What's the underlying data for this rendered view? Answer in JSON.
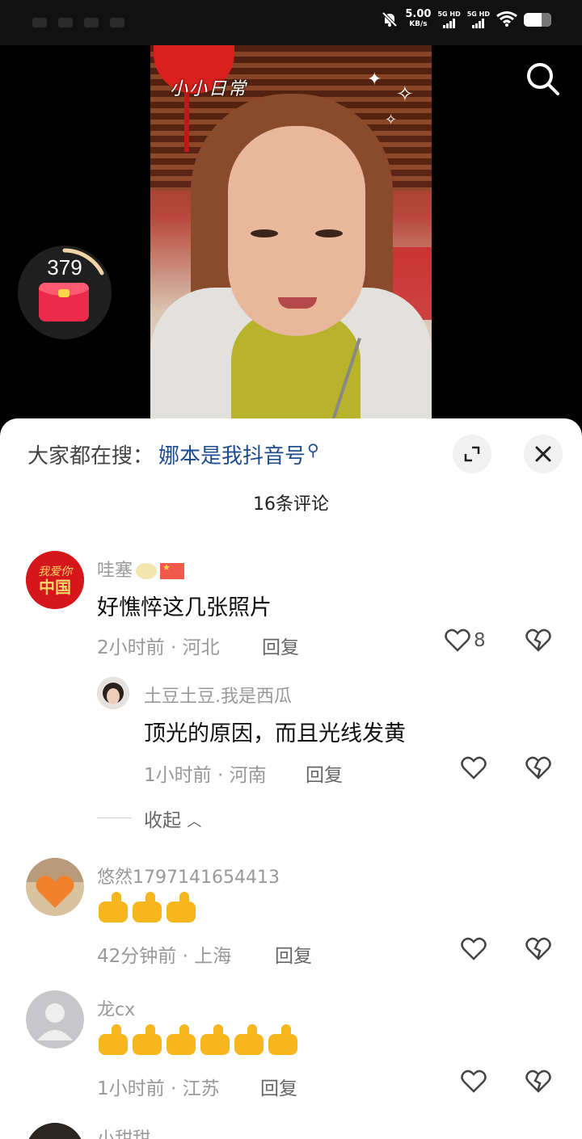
{
  "status_bar": {
    "net_speed": "5.00",
    "net_speed_unit": "KB/s",
    "sim1": "5G HD",
    "sim2": "5G HD"
  },
  "video": {
    "sticker_text": "小小日常",
    "red_packet_count": "379"
  },
  "sheet": {
    "hot_search_label": "大家都在搜：",
    "hot_search_term": "娜本是我抖音号",
    "comment_count": "16条评论"
  },
  "comments": [
    {
      "username": "哇塞",
      "text": "好憔悴这几张照片",
      "time": "2小时前",
      "location": "河北",
      "reply_label": "回复",
      "likes": "8"
    },
    {
      "username": "土豆土豆.我是西瓜",
      "text": "顶光的原因，而且光线发黄",
      "time": "1小时前",
      "location": "河南",
      "reply_label": "回复"
    },
    {
      "username": "悠然1797141654413",
      "time": "42分钟前",
      "location": "上海",
      "reply_label": "回复"
    },
    {
      "username": "龙cx",
      "time": "1小时前",
      "location": "江苏",
      "reply_label": "回复"
    },
    {
      "username": "小甜甜"
    }
  ],
  "collapse_label": "收起",
  "avatar_text": "我爱你中国",
  "colors": {
    "accent_link": "#1d4c8f",
    "red_packet": "#ee2a4a"
  }
}
